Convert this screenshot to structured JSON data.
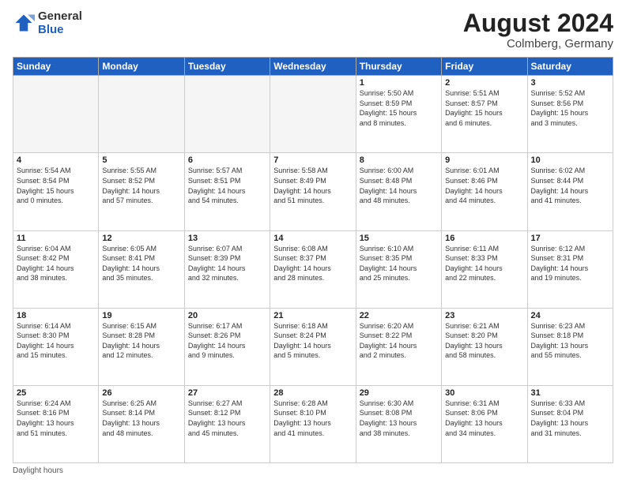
{
  "header": {
    "logo_line1": "General",
    "logo_line2": "Blue",
    "month_year": "August 2024",
    "location": "Colmberg, Germany"
  },
  "footer": {
    "daylight_label": "Daylight hours"
  },
  "weekdays": [
    "Sunday",
    "Monday",
    "Tuesday",
    "Wednesday",
    "Thursday",
    "Friday",
    "Saturday"
  ],
  "weeks": [
    [
      {
        "day": "",
        "info": ""
      },
      {
        "day": "",
        "info": ""
      },
      {
        "day": "",
        "info": ""
      },
      {
        "day": "",
        "info": ""
      },
      {
        "day": "1",
        "info": "Sunrise: 5:50 AM\nSunset: 8:59 PM\nDaylight: 15 hours\nand 8 minutes."
      },
      {
        "day": "2",
        "info": "Sunrise: 5:51 AM\nSunset: 8:57 PM\nDaylight: 15 hours\nand 6 minutes."
      },
      {
        "day": "3",
        "info": "Sunrise: 5:52 AM\nSunset: 8:56 PM\nDaylight: 15 hours\nand 3 minutes."
      }
    ],
    [
      {
        "day": "4",
        "info": "Sunrise: 5:54 AM\nSunset: 8:54 PM\nDaylight: 15 hours\nand 0 minutes."
      },
      {
        "day": "5",
        "info": "Sunrise: 5:55 AM\nSunset: 8:52 PM\nDaylight: 14 hours\nand 57 minutes."
      },
      {
        "day": "6",
        "info": "Sunrise: 5:57 AM\nSunset: 8:51 PM\nDaylight: 14 hours\nand 54 minutes."
      },
      {
        "day": "7",
        "info": "Sunrise: 5:58 AM\nSunset: 8:49 PM\nDaylight: 14 hours\nand 51 minutes."
      },
      {
        "day": "8",
        "info": "Sunrise: 6:00 AM\nSunset: 8:48 PM\nDaylight: 14 hours\nand 48 minutes."
      },
      {
        "day": "9",
        "info": "Sunrise: 6:01 AM\nSunset: 8:46 PM\nDaylight: 14 hours\nand 44 minutes."
      },
      {
        "day": "10",
        "info": "Sunrise: 6:02 AM\nSunset: 8:44 PM\nDaylight: 14 hours\nand 41 minutes."
      }
    ],
    [
      {
        "day": "11",
        "info": "Sunrise: 6:04 AM\nSunset: 8:42 PM\nDaylight: 14 hours\nand 38 minutes."
      },
      {
        "day": "12",
        "info": "Sunrise: 6:05 AM\nSunset: 8:41 PM\nDaylight: 14 hours\nand 35 minutes."
      },
      {
        "day": "13",
        "info": "Sunrise: 6:07 AM\nSunset: 8:39 PM\nDaylight: 14 hours\nand 32 minutes."
      },
      {
        "day": "14",
        "info": "Sunrise: 6:08 AM\nSunset: 8:37 PM\nDaylight: 14 hours\nand 28 minutes."
      },
      {
        "day": "15",
        "info": "Sunrise: 6:10 AM\nSunset: 8:35 PM\nDaylight: 14 hours\nand 25 minutes."
      },
      {
        "day": "16",
        "info": "Sunrise: 6:11 AM\nSunset: 8:33 PM\nDaylight: 14 hours\nand 22 minutes."
      },
      {
        "day": "17",
        "info": "Sunrise: 6:12 AM\nSunset: 8:31 PM\nDaylight: 14 hours\nand 19 minutes."
      }
    ],
    [
      {
        "day": "18",
        "info": "Sunrise: 6:14 AM\nSunset: 8:30 PM\nDaylight: 14 hours\nand 15 minutes."
      },
      {
        "day": "19",
        "info": "Sunrise: 6:15 AM\nSunset: 8:28 PM\nDaylight: 14 hours\nand 12 minutes."
      },
      {
        "day": "20",
        "info": "Sunrise: 6:17 AM\nSunset: 8:26 PM\nDaylight: 14 hours\nand 9 minutes."
      },
      {
        "day": "21",
        "info": "Sunrise: 6:18 AM\nSunset: 8:24 PM\nDaylight: 14 hours\nand 5 minutes."
      },
      {
        "day": "22",
        "info": "Sunrise: 6:20 AM\nSunset: 8:22 PM\nDaylight: 14 hours\nand 2 minutes."
      },
      {
        "day": "23",
        "info": "Sunrise: 6:21 AM\nSunset: 8:20 PM\nDaylight: 13 hours\nand 58 minutes."
      },
      {
        "day": "24",
        "info": "Sunrise: 6:23 AM\nSunset: 8:18 PM\nDaylight: 13 hours\nand 55 minutes."
      }
    ],
    [
      {
        "day": "25",
        "info": "Sunrise: 6:24 AM\nSunset: 8:16 PM\nDaylight: 13 hours\nand 51 minutes."
      },
      {
        "day": "26",
        "info": "Sunrise: 6:25 AM\nSunset: 8:14 PM\nDaylight: 13 hours\nand 48 minutes."
      },
      {
        "day": "27",
        "info": "Sunrise: 6:27 AM\nSunset: 8:12 PM\nDaylight: 13 hours\nand 45 minutes."
      },
      {
        "day": "28",
        "info": "Sunrise: 6:28 AM\nSunset: 8:10 PM\nDaylight: 13 hours\nand 41 minutes."
      },
      {
        "day": "29",
        "info": "Sunrise: 6:30 AM\nSunset: 8:08 PM\nDaylight: 13 hours\nand 38 minutes."
      },
      {
        "day": "30",
        "info": "Sunrise: 6:31 AM\nSunset: 8:06 PM\nDaylight: 13 hours\nand 34 minutes."
      },
      {
        "day": "31",
        "info": "Sunrise: 6:33 AM\nSunset: 8:04 PM\nDaylight: 13 hours\nand 31 minutes."
      }
    ]
  ]
}
